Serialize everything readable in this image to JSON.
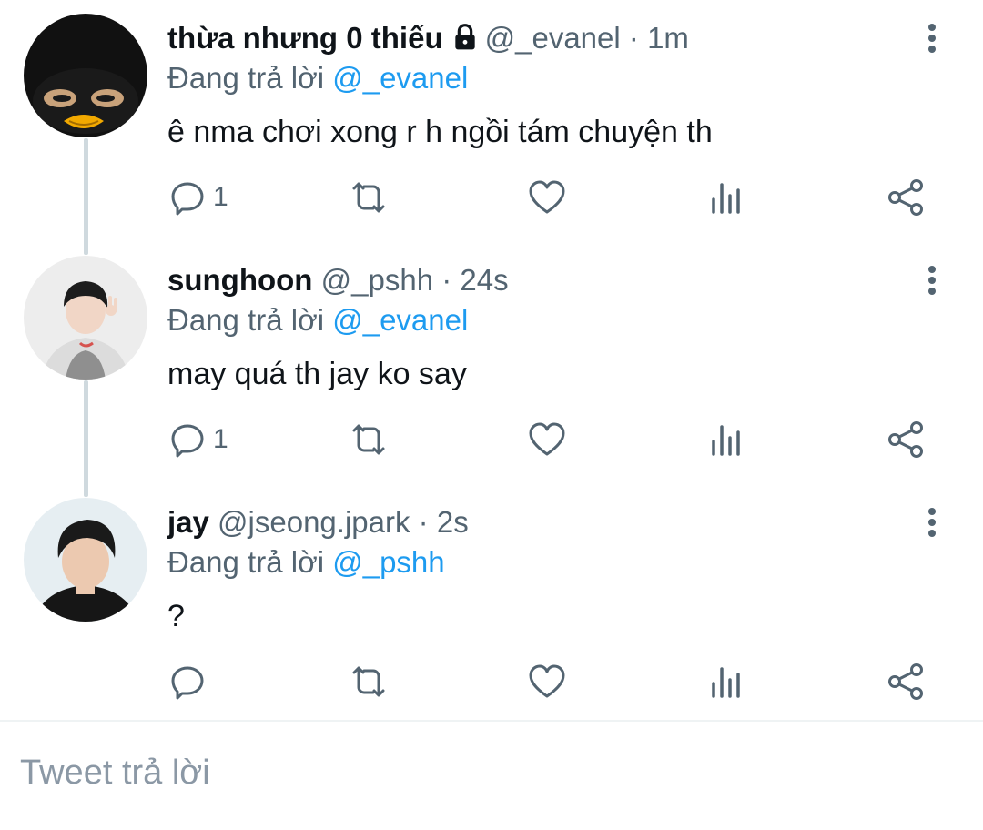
{
  "tweets": [
    {
      "name": "thừa nhưng 0 thiếu",
      "locked": true,
      "handle": "@_evanel",
      "separator": "·",
      "time": "1m",
      "replying_prefix": "Đang trả lời",
      "replying_to": "@_evanel",
      "text": "ê nma chơi xong r h ngồi tám chuyện th",
      "reply_count": "1",
      "avatar_icon": "penguin-avatar"
    },
    {
      "name": "sunghoon",
      "locked": false,
      "handle": "@_pshh",
      "separator": "·",
      "time": "24s",
      "replying_prefix": "Đang trả lời",
      "replying_to": "@_evanel",
      "text": "may quá th jay ko say",
      "reply_count": "1",
      "avatar_icon": "user-photo-avatar"
    },
    {
      "name": "jay",
      "locked": false,
      "handle": "@jseong.jpark",
      "separator": "·",
      "time": "2s",
      "replying_prefix": "Đang trả lời",
      "replying_to": "@_pshh",
      "text": "?",
      "reply_count": "",
      "avatar_icon": "user-photo-avatar"
    }
  ],
  "reply_box": {
    "placeholder": "Tweet trả lời"
  },
  "colors": {
    "accent": "#1d9bf0",
    "text_primary": "#0f1419",
    "text_secondary": "#536471",
    "icon": "#536471",
    "thread_line": "#cfd9de"
  }
}
